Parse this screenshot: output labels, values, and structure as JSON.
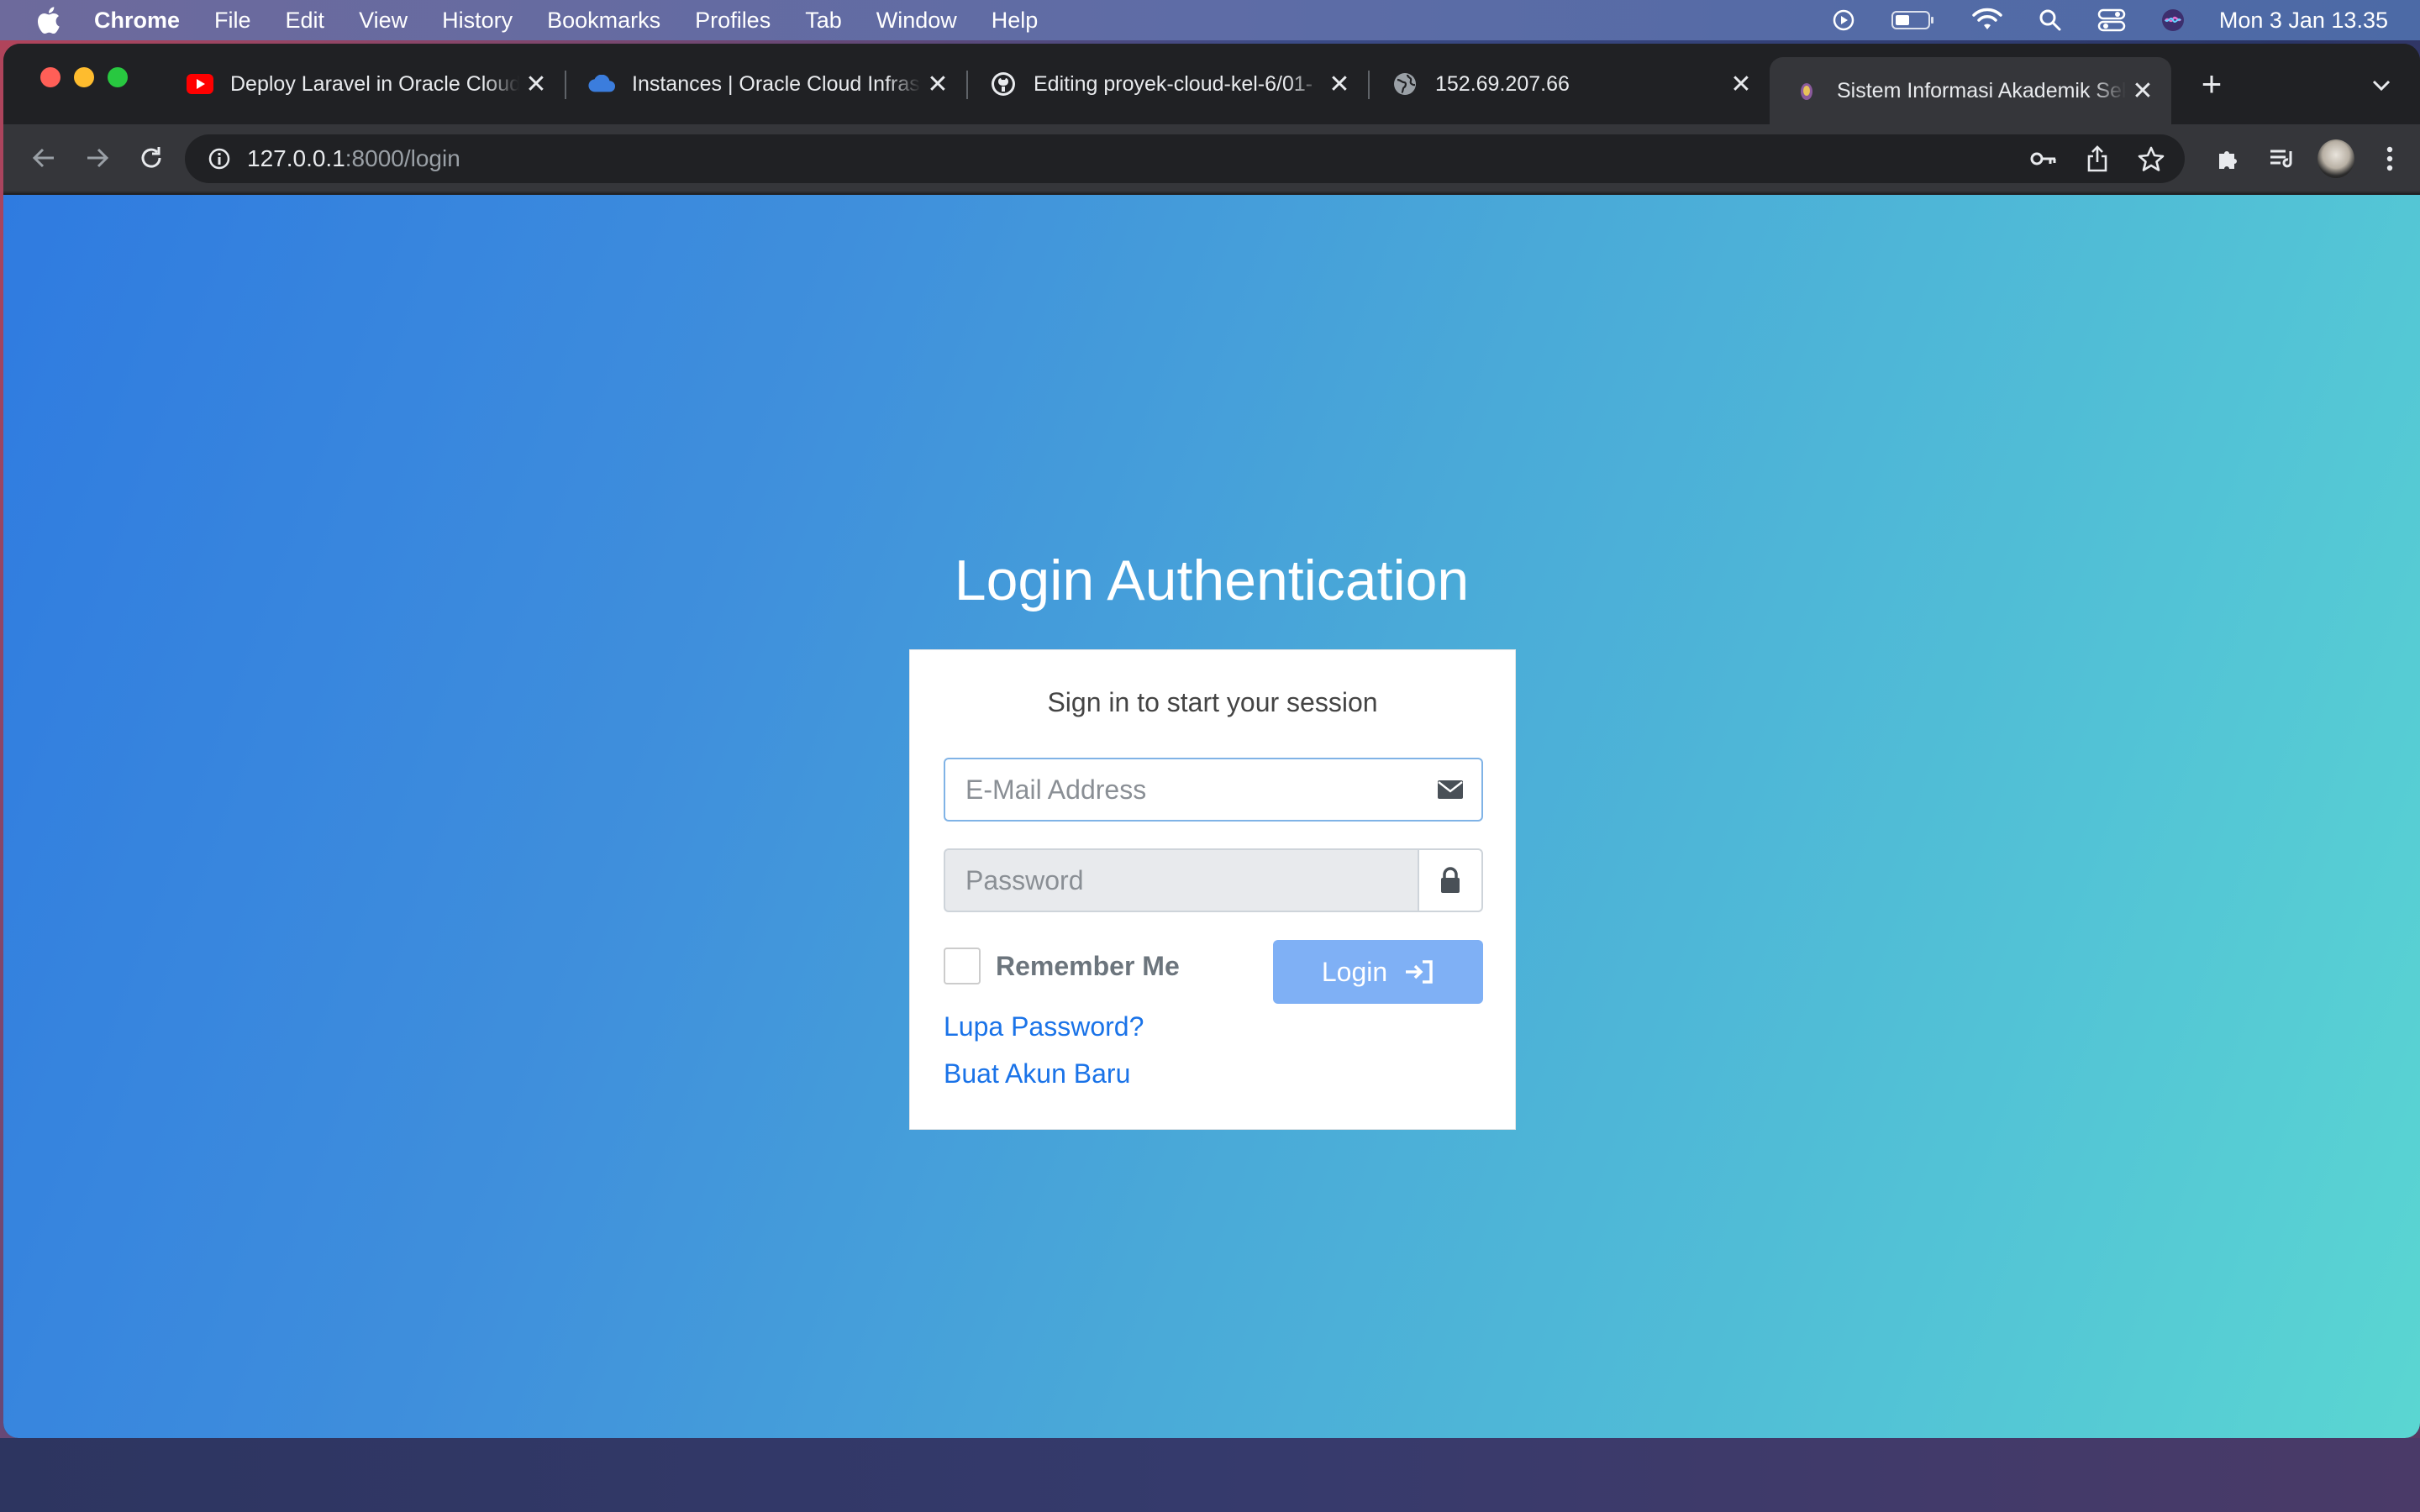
{
  "menubar": {
    "app": "Chrome",
    "items": [
      "File",
      "Edit",
      "View",
      "History",
      "Bookmarks",
      "Profiles",
      "Tab",
      "Window",
      "Help"
    ],
    "clock": "Mon 3 Jan  13.35",
    "status_icons": [
      "play-circle-icon",
      "battery-icon",
      "wifi-icon",
      "search-icon",
      "control-center-icon",
      "siri-icon"
    ]
  },
  "tabs": [
    {
      "title": "Deploy Laravel in Oracle Cloud",
      "favicon": "youtube-icon"
    },
    {
      "title": "Instances | Oracle Cloud Infrastructure",
      "favicon": "cloud-icon"
    },
    {
      "title": "Editing proyek-cloud-kel-6/01-",
      "favicon": "github-icon"
    },
    {
      "title": "152.69.207.66",
      "favicon": "globe-icon"
    },
    {
      "title": "Sistem Informasi Akademik Sekolah",
      "favicon": "school-icon",
      "active": true
    }
  ],
  "toolbar": {
    "url_host": "127.0.0.1",
    "url_rest": ":8000/login"
  },
  "page": {
    "heading": "Login Authentication",
    "subtitle": "Sign in to start your session",
    "email_placeholder": "E-Mail Address",
    "password_placeholder": "Password",
    "remember_label": "Remember Me",
    "login_label": "Login",
    "forgot_link": "Lupa Password?",
    "register_link": "Buat Akun Baru"
  },
  "colors": {
    "gradient_start": "#2f7be0",
    "gradient_end": "#5ad6d2",
    "login_button": "#7fb0f5",
    "link": "#1a73e8"
  }
}
